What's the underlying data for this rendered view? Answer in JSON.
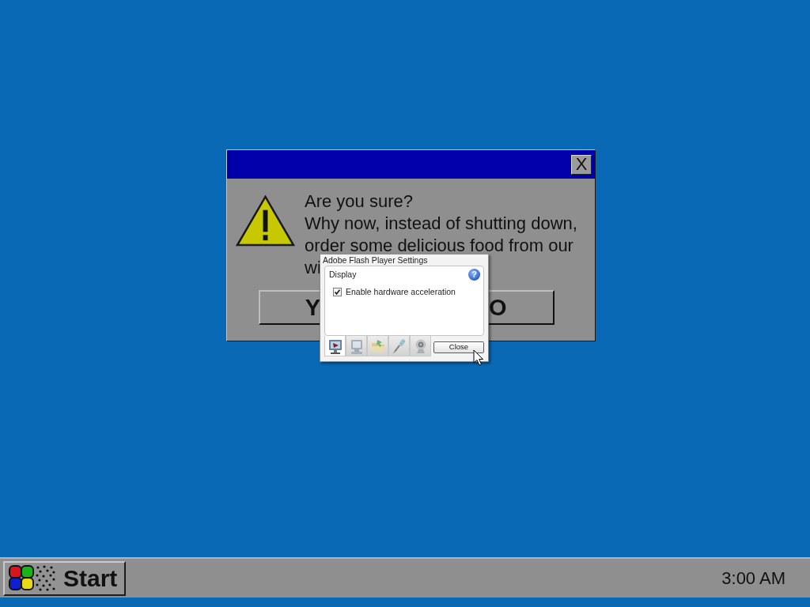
{
  "dialog": {
    "close_label": "X",
    "heading": "Are you sure?",
    "message_lines": [
      "Why now, instead of shutting down,",
      "order some delicious food from our",
      "wi"
    ],
    "buttons": [
      "Y",
      "O"
    ]
  },
  "flash_settings": {
    "title": "Adobe Flash Player Settings",
    "section": "Display",
    "help_label": "?",
    "option": {
      "label": "Enable hardware acceleration",
      "checked": true
    },
    "tabs": [
      {
        "kind": "display",
        "selected": true
      },
      {
        "kind": "privacy",
        "selected": false
      },
      {
        "kind": "storage",
        "selected": false
      },
      {
        "kind": "microphone",
        "selected": false
      },
      {
        "kind": "camera",
        "selected": false
      }
    ],
    "close_button": "Close"
  },
  "taskbar": {
    "start_label": "Start",
    "clock": "3:00 AM"
  }
}
